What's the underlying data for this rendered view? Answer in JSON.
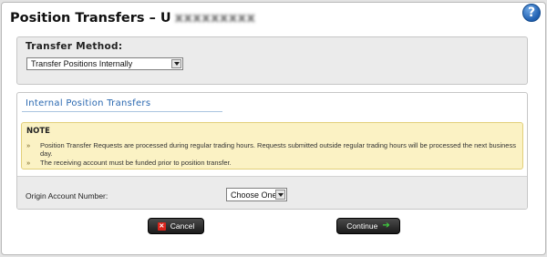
{
  "header": {
    "title": "Position Transfers – U",
    "account_masked": "xxxxxxxxx",
    "help_label": "?"
  },
  "transfer_method": {
    "label": "Transfer Method:",
    "selected": "Transfer Positions Internally"
  },
  "internal": {
    "title": "Internal Position Transfers",
    "note": {
      "title": "NOTE",
      "items": [
        "Position Transfer Requests are processed during regular trading hours. Requests submitted outside regular trading hours will be processed the next business day.",
        "The receiving account must be funded prior to position transfer."
      ]
    },
    "origin": {
      "label": "Origin Account Number:",
      "selected": "Choose One"
    }
  },
  "buttons": {
    "cancel_label": "Cancel",
    "continue_label": "Continue"
  },
  "icons": {
    "help": "help-icon",
    "cancel": "close-icon",
    "continue": "arrow-right-icon",
    "dropdown": "chevron-down-icon",
    "bullet": "double-chevron-right-icon"
  },
  "colors": {
    "section_title": "#2a68b0",
    "note_bg": "#fbf2c4",
    "cancel_icon": "#d9241b",
    "continue_icon": "#3fcf3f"
  }
}
